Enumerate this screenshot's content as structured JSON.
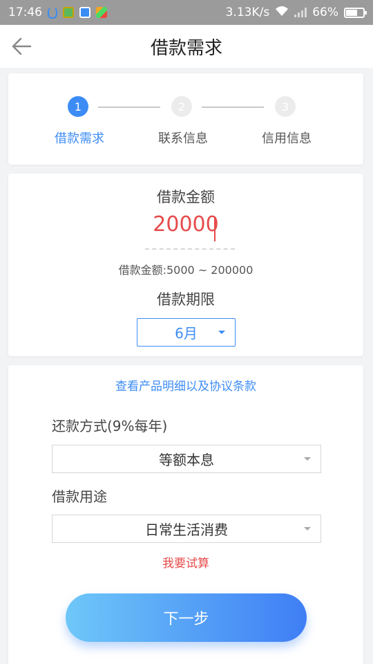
{
  "status_bar": {
    "time": "17:46",
    "net_speed": "3.13K/s",
    "battery": "66%",
    "battery_level": 0.66
  },
  "header": {
    "title": "借款需求"
  },
  "steps": [
    {
      "number": "1",
      "label": "借款需求",
      "active": true
    },
    {
      "number": "2",
      "label": "联系信息",
      "active": false
    },
    {
      "number": "3",
      "label": "信用信息",
      "active": false
    }
  ],
  "amount": {
    "label": "借款金额",
    "value": "20000",
    "range_text": "借款金额:5000 ~ 200000"
  },
  "term": {
    "label": "借款期限",
    "selected": "6月"
  },
  "terms_link": "查看产品明细以及协议条款",
  "repayment": {
    "label": "还款方式(9%每年)",
    "selected": "等额本息"
  },
  "purpose": {
    "label": "借款用途",
    "selected": "日常生活消费"
  },
  "calc_link": "我要试算",
  "next_button": "下一步",
  "colors": {
    "accent": "#3d8cf5",
    "alert": "#e64b4b"
  }
}
